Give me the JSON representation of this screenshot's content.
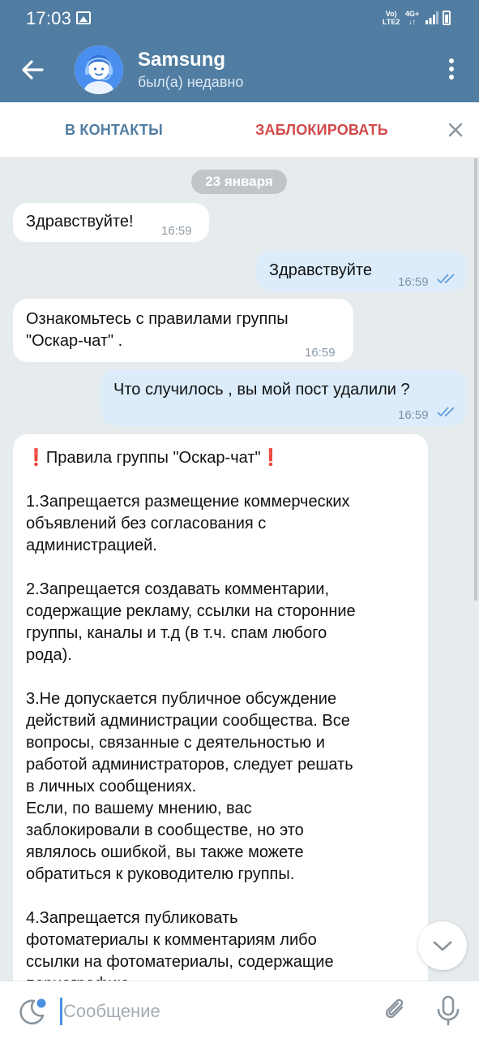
{
  "status_bar": {
    "time": "17:03",
    "net_line1": "Vo)",
    "net_line2": "LTE2",
    "net2_line1": "4G+",
    "net2_line2": "↓↑"
  },
  "header": {
    "title": "Samsung",
    "subtitle": "был(а) недавно"
  },
  "action_bar": {
    "add_contact": "В КОНТАКТЫ",
    "block": "ЗАБЛОКИРОВАТЬ"
  },
  "date_divider": "23 января",
  "messages": [
    {
      "dir": "in",
      "text": "Здравствуйте!",
      "time": "16:59"
    },
    {
      "dir": "out",
      "text": "Здравствуйте",
      "time": "16:59"
    },
    {
      "dir": "in",
      "text": "Ознакомьтесь с правилами группы\n\"Оскар-чат\" .",
      "time": "16:59"
    },
    {
      "dir": "out",
      "text": "Что случилось , вы мой пост удалили ?",
      "time": "16:59"
    }
  ],
  "rules_message": {
    "title": "Правила группы \"Оскар-чат\"",
    "body": "1.Запрещается размещение коммерческих\nобъявлений без согласования с\nадминистрацией.\n\n2.Запрещается создавать комментарии,\nсодержащие рекламу, ссылки на сторонние\nгруппы, каналы и т.д (в т.ч. спам любого\nрода).\n\n3.Не допускается публичное обсуждение\nдействий администрации сообщества. Все\nвопросы, связанные с деятельностью и\nработой администраторов, следует решать\nв личных сообщениях.\nЕсли, по вашему мнению, вас\nзаблокировали в сообществе, но это\nявлялось ошибкой, вы также можете\nобратиться к руководителю группы.\n\n4.Запрещается публиковать\nфотоматериалы к комментариям либо\nссылки на фотоматериалы, содержащие\nпорнографию,"
  },
  "input": {
    "placeholder": "Сообщение"
  },
  "colors": {
    "header": "#517da2",
    "block_red": "#d24949",
    "out_bubble": "#dcecfb",
    "background": "#e6ebee"
  },
  "icons": {
    "back": "arrow-left",
    "menu": "kebab-vertical",
    "close": "x",
    "scroll_down": "chevron-down",
    "emoji": "moon-sticker",
    "attach": "paperclip",
    "mic": "microphone",
    "read_receipt": "double-check"
  }
}
